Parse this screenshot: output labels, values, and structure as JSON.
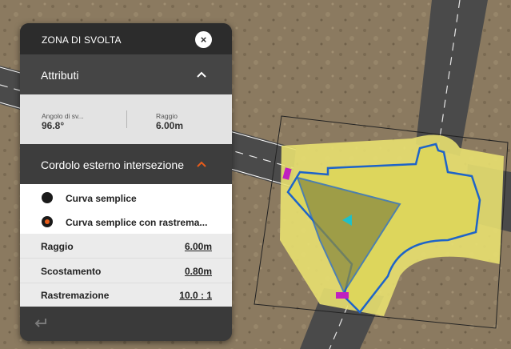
{
  "panel": {
    "title": "ZONA DI SVOLTA",
    "close_icon": "×",
    "attributes": {
      "title": "Attributi",
      "angle_label": "Angolo di sv...",
      "angle_value": "96.8°",
      "radius_label": "Raggio",
      "radius_value": "6.00m"
    },
    "cordolo": {
      "title": "Cordolo esterno intersezione",
      "options": [
        {
          "label": "Curva semplice",
          "selected": false
        },
        {
          "label": "Curva semplice con rastrema...",
          "selected": true
        }
      ],
      "properties": [
        {
          "label": "Raggio",
          "value": "6.00m"
        },
        {
          "label": "Scostamento",
          "value": "0.80m"
        },
        {
          "label": "Rastremazione",
          "value": "10.0 : 1"
        }
      ]
    }
  },
  "colors": {
    "accent": "#e85c1a",
    "zone_fill": "#e8e070",
    "edge_blue": "#1e64c8",
    "grip_magenta": "#c020c0",
    "grip_cyan": "#20c0c8",
    "road": "#4a4a4a"
  }
}
